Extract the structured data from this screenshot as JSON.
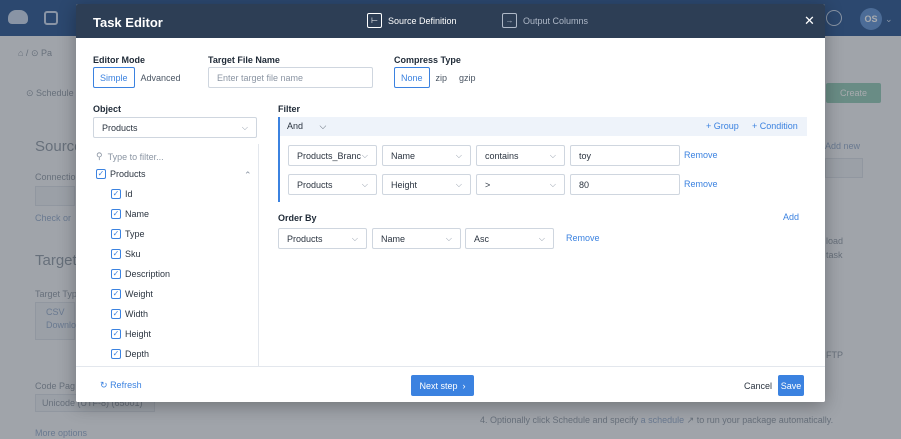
{
  "background": {
    "avatar_initials": "OS",
    "breadcrumb_text": "Pa",
    "schedule_text": "Schedule",
    "create_label": "Create",
    "source_heading": "Source",
    "connection_label": "Connectio",
    "check_or_text": "Check or",
    "add_new_label": "Add new",
    "target_heading": "Target",
    "target_type_label": "Target Typ",
    "csv_label": "CSV",
    "download_label": "Downlo",
    "load_text": "load",
    "task_text": "task",
    "ftp_text": "FTP",
    "code_page_label": "Code Pag",
    "code_page_value": "Unicode (UTF-8) (65001)",
    "more_options_label": "More options",
    "instruction_text": "4. Optionally click Schedule and specify",
    "instruction_link": "a schedule",
    "instruction_end": "to run your package automatically."
  },
  "modal": {
    "title": "Task Editor",
    "steps": [
      {
        "label": "Source Definition",
        "icon": "source-definition-icon"
      },
      {
        "label": "Output Columns",
        "icon": "output-columns-icon"
      }
    ],
    "close_icon": "close-icon"
  },
  "editor_mode": {
    "label": "Editor Mode",
    "options": [
      "Simple",
      "Advanced"
    ],
    "selected": "Simple"
  },
  "target_file": {
    "label": "Target File Name",
    "placeholder": "Enter target file name",
    "value": ""
  },
  "compress": {
    "label": "Compress Type",
    "options": [
      "None",
      "zip",
      "gzip"
    ],
    "selected": "None"
  },
  "object": {
    "label": "Object",
    "selected": "Products",
    "search_placeholder": "Type to filter...",
    "tree": [
      {
        "label": "Products",
        "checked": true,
        "expanded": true,
        "level": 0
      },
      {
        "label": "Id",
        "checked": true,
        "level": 1
      },
      {
        "label": "Name",
        "checked": true,
        "level": 1
      },
      {
        "label": "Type",
        "checked": true,
        "level": 1
      },
      {
        "label": "Sku",
        "checked": true,
        "level": 1
      },
      {
        "label": "Description",
        "checked": true,
        "level": 1
      },
      {
        "label": "Weight",
        "checked": true,
        "level": 1
      },
      {
        "label": "Width",
        "checked": true,
        "level": 1
      },
      {
        "label": "Height",
        "checked": true,
        "level": 1
      },
      {
        "label": "Depth",
        "checked": true,
        "level": 1
      }
    ]
  },
  "filter": {
    "label": "Filter",
    "operator": "And",
    "add_group_label": "+ Group",
    "add_condition_label": "+ Condition",
    "conditions": [
      {
        "object": "Products_Branc",
        "field": "Name",
        "op": "contains",
        "value": "toy",
        "remove_label": "Remove"
      },
      {
        "object": "Products",
        "field": "Height",
        "op": ">",
        "value": "80",
        "remove_label": "Remove"
      }
    ]
  },
  "order_by": {
    "label": "Order By",
    "add_label": "Add",
    "rows": [
      {
        "object": "Products",
        "field": "Name",
        "direction": "Asc",
        "remove_label": "Remove"
      }
    ]
  },
  "footer": {
    "refresh_label": "Refresh",
    "next_label": "Next step",
    "cancel_label": "Cancel",
    "save_label": "Save"
  },
  "colors": {
    "header_bg": "#2d3e55",
    "accent": "#3b82e0",
    "app_bar": "#1f4e8c"
  }
}
